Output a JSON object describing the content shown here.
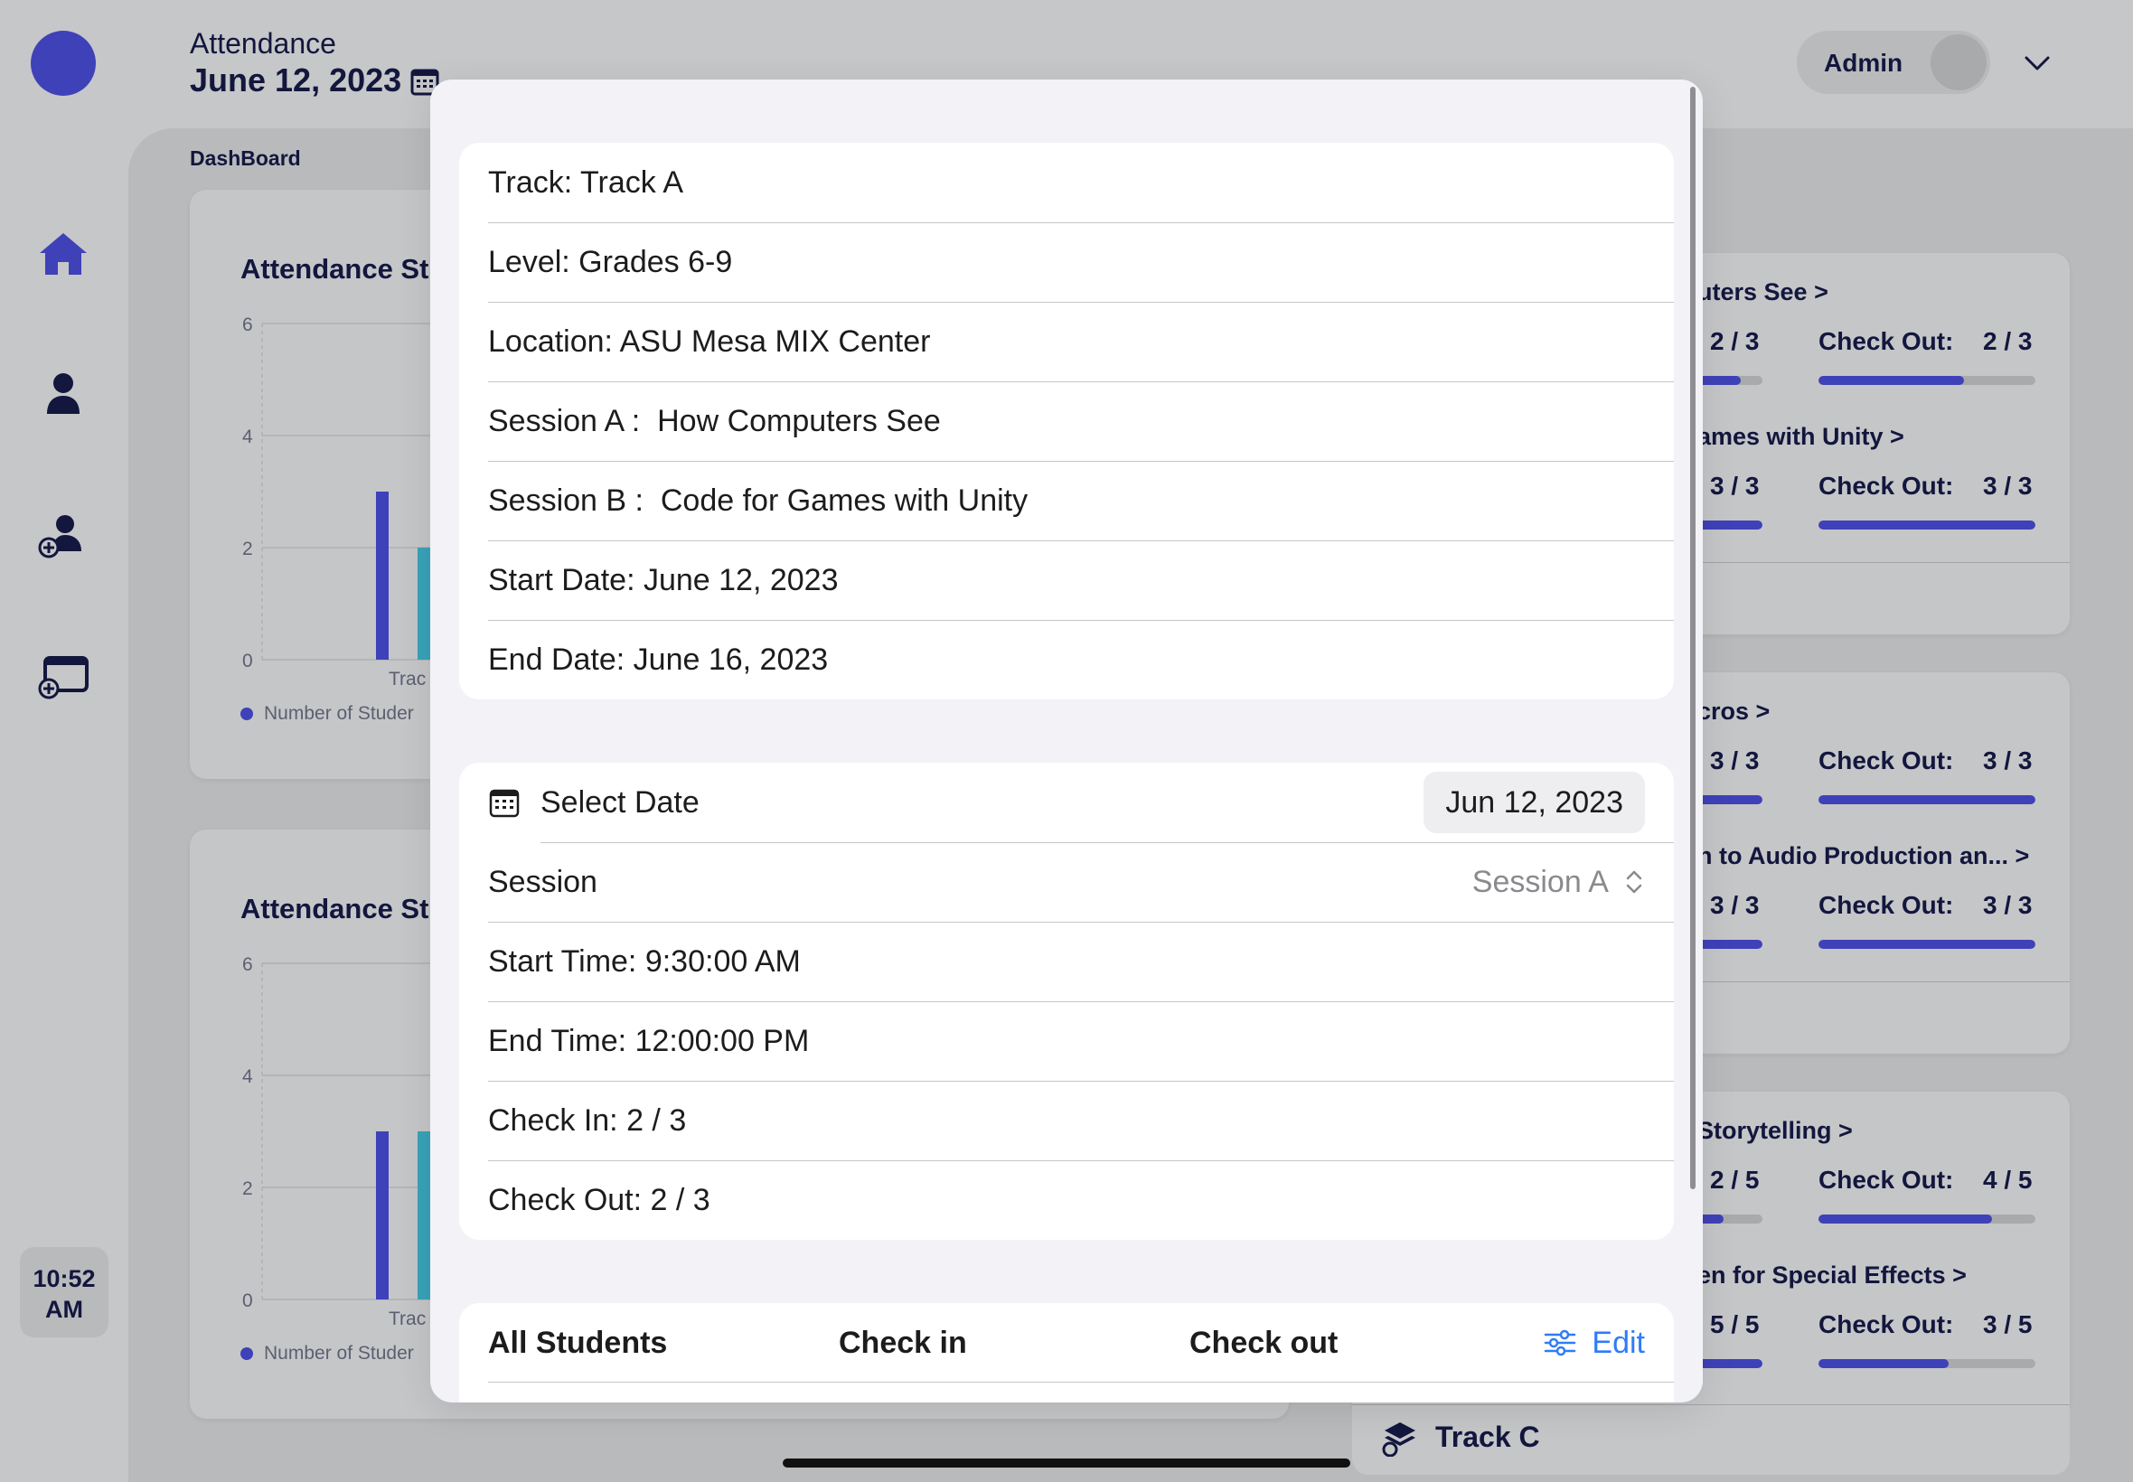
{
  "header": {
    "title": "Attendance",
    "date": "June 12, 2023",
    "user_label": "Admin"
  },
  "sidebar": {
    "time_line1": "10:52",
    "time_line2": "AM",
    "icons": [
      "home-icon",
      "person-icon",
      "add-person-icon",
      "add-device-icon"
    ]
  },
  "dashboard": {
    "label": "DashBoard",
    "charts": [
      {
        "title": "Attendance St",
        "legend": "Number of Studer",
        "x_tick": "Trac"
      },
      {
        "title": "Attendance St",
        "legend": "Number of Studer",
        "x_tick": "Trac"
      }
    ],
    "tracks": [
      {
        "sessions": [
          {
            "title": "uters See >",
            "check_in": "2 / 3",
            "check_out_label": "Check Out:",
            "check_out": "2 / 3",
            "in_frac": 0.67,
            "out_frac": 0.67
          },
          {
            "title": "ames with Unity >",
            "check_in": "3 / 3",
            "check_out_label": "Check Out:",
            "check_out": "3 / 3",
            "in_frac": 1.0,
            "out_frac": 1.0
          }
        ]
      },
      {
        "sessions": [
          {
            "title": "cros >",
            "check_in": "3 / 3",
            "check_out_label": "Check Out:",
            "check_out": "3 / 3",
            "in_frac": 1.0,
            "out_frac": 1.0
          },
          {
            "title": "n to Audio Production an... >",
            "check_in": "3 / 3",
            "check_out_label": "Check Out:",
            "check_out": "3 / 3",
            "in_frac": 1.0,
            "out_frac": 1.0
          }
        ]
      },
      {
        "sessions": [
          {
            "title": "Storytelling >",
            "check_in": "2 / 5",
            "check_out_label": "Check Out:",
            "check_out": "4 / 5",
            "in_frac": 0.4,
            "out_frac": 0.8
          },
          {
            "title": "en for Special Effects >",
            "check_in": "5 / 5",
            "check_out_label": "Check Out:",
            "check_out": "3 / 5",
            "in_frac": 1.0,
            "out_frac": 0.6
          }
        ]
      }
    ],
    "footer_track": "Track C"
  },
  "modal": {
    "info": [
      "Track: Track A",
      "Level: Grades 6-9",
      "Location: ASU Mesa MIX Center",
      "Session A :  How Computers See",
      "Session B :  Code for Games with Unity",
      "Start Date: June 12, 2023",
      "End Date: June 16, 2023"
    ],
    "select_date_label": "Select Date",
    "select_date_value": "Jun 12, 2023",
    "session_label": "Session",
    "session_value": "Session A",
    "start_time": "Start Time: 9:30:00 AM",
    "end_time": "End Time: 12:00:00 PM",
    "check_in": "Check In: 2 / 3",
    "check_out": "Check Out: 2 / 3",
    "table": {
      "col_students": "All Students",
      "col_check_in": "Check in",
      "col_check_out": "Check out",
      "edit_label": "Edit"
    }
  },
  "colors": {
    "brand": "#3f41b8",
    "teal": "#3aa3b8",
    "link": "#2f7cf6"
  }
}
